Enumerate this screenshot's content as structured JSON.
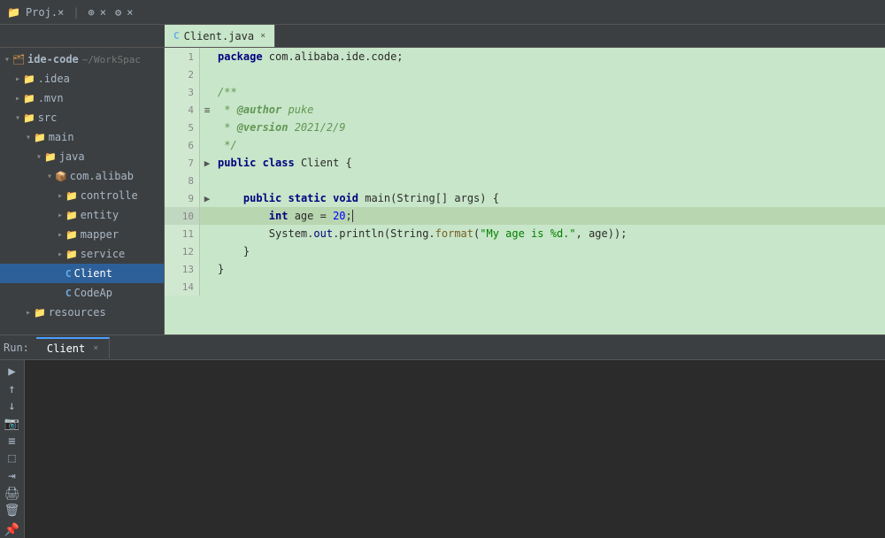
{
  "topbar": {
    "project_icon": "📁",
    "project_name": "Proj.×",
    "actions": [
      "⊕",
      "×",
      "⚙",
      "×"
    ]
  },
  "tabs": [
    {
      "label": "Client.java",
      "icon": "C",
      "active": true,
      "closable": true
    }
  ],
  "sidebar": {
    "title": "ide-code",
    "subtitle": "~/WorkSpac",
    "items": [
      {
        "id": "ide-code",
        "label": "ide-code",
        "indent": 0,
        "type": "root",
        "arrow": "▾",
        "icon": "📁"
      },
      {
        "id": "idea",
        "label": ".idea",
        "indent": 1,
        "type": "folder",
        "arrow": "▸",
        "icon": "📁"
      },
      {
        "id": "mvn",
        "label": ".mvn",
        "indent": 1,
        "type": "folder",
        "arrow": "▸",
        "icon": "📁"
      },
      {
        "id": "src",
        "label": "src",
        "indent": 1,
        "type": "src-folder",
        "arrow": "▾",
        "icon": "📁"
      },
      {
        "id": "main",
        "label": "main",
        "indent": 2,
        "type": "folder",
        "arrow": "▾",
        "icon": "📁"
      },
      {
        "id": "java",
        "label": "java",
        "indent": 3,
        "type": "java-folder",
        "arrow": "▾",
        "icon": "📁"
      },
      {
        "id": "com.alibab",
        "label": "com.alibab",
        "indent": 4,
        "type": "package",
        "arrow": "▾",
        "icon": "📦"
      },
      {
        "id": "controlle",
        "label": "controlle",
        "indent": 5,
        "type": "folder",
        "arrow": "▸",
        "icon": "📁"
      },
      {
        "id": "entity",
        "label": "entity",
        "indent": 5,
        "type": "folder",
        "arrow": "▸",
        "icon": "📁"
      },
      {
        "id": "mapper",
        "label": "mapper",
        "indent": 5,
        "type": "folder",
        "arrow": "▸",
        "icon": "📁"
      },
      {
        "id": "service",
        "label": "service",
        "indent": 5,
        "type": "folder",
        "arrow": "▸",
        "icon": "📁"
      },
      {
        "id": "Client",
        "label": "Client",
        "indent": 5,
        "type": "class",
        "arrow": "",
        "icon": "C",
        "selected": true
      },
      {
        "id": "CodeApp",
        "label": "CodeAp",
        "indent": 5,
        "type": "class",
        "arrow": "",
        "icon": "C"
      },
      {
        "id": "resources",
        "label": "resources",
        "indent": 2,
        "type": "folder",
        "arrow": "▸",
        "icon": "📁"
      }
    ]
  },
  "editor": {
    "lines": [
      {
        "num": 1,
        "arrow": "",
        "highlighted": false,
        "tokens": [
          {
            "t": "kw",
            "v": "package"
          },
          {
            "t": "plain",
            "v": " com.alibaba.ide.code;"
          }
        ]
      },
      {
        "num": 2,
        "arrow": "",
        "highlighted": false,
        "tokens": []
      },
      {
        "num": 3,
        "arrow": "",
        "highlighted": false,
        "tokens": [
          {
            "t": "cm",
            "v": "/**"
          }
        ]
      },
      {
        "num": 4,
        "arrow": "",
        "highlighted": false,
        "tokens": [
          {
            "t": "cm",
            "v": " * "
          },
          {
            "t": "cm-tag",
            "v": "@author"
          },
          {
            "t": "cm",
            "v": " puke"
          }
        ]
      },
      {
        "num": 5,
        "arrow": "",
        "highlighted": false,
        "tokens": [
          {
            "t": "cm",
            "v": " * "
          },
          {
            "t": "cm-tag",
            "v": "@version"
          },
          {
            "t": "cm",
            "v": " 2021/2/9"
          }
        ]
      },
      {
        "num": 6,
        "arrow": "",
        "highlighted": false,
        "tokens": [
          {
            "t": "cm",
            "v": " */"
          }
        ]
      },
      {
        "num": 7,
        "arrow": "▶",
        "highlighted": false,
        "tokens": [
          {
            "t": "kw",
            "v": "public"
          },
          {
            "t": "plain",
            "v": " "
          },
          {
            "t": "kw",
            "v": "class"
          },
          {
            "t": "plain",
            "v": " Client {"
          }
        ]
      },
      {
        "num": 8,
        "arrow": "",
        "highlighted": false,
        "tokens": []
      },
      {
        "num": 9,
        "arrow": "▶",
        "highlighted": false,
        "tokens": [
          {
            "t": "plain",
            "v": "    "
          },
          {
            "t": "kw",
            "v": "public"
          },
          {
            "t": "plain",
            "v": " "
          },
          {
            "t": "kw",
            "v": "static"
          },
          {
            "t": "plain",
            "v": " "
          },
          {
            "t": "kw",
            "v": "void"
          },
          {
            "t": "plain",
            "v": " main(String[] args) {"
          }
        ]
      },
      {
        "num": 10,
        "arrow": "",
        "highlighted": true,
        "tokens": [
          {
            "t": "plain",
            "v": "        "
          },
          {
            "t": "kw",
            "v": "int"
          },
          {
            "t": "plain",
            "v": " age = "
          },
          {
            "t": "num",
            "v": "20"
          },
          {
            "t": "plain",
            "v": ";"
          }
        ],
        "caret_after": 5
      },
      {
        "num": 11,
        "arrow": "",
        "highlighted": false,
        "tokens": [
          {
            "t": "plain",
            "v": "        System."
          },
          {
            "t": "plain",
            "v": "out"
          },
          {
            "t": "plain",
            "v": ".println(String."
          },
          {
            "t": "fn",
            "v": "format"
          },
          {
            "t": "plain",
            "v": "("
          },
          {
            "t": "str",
            "v": "\"My age is %d.\""
          },
          {
            "t": "plain",
            "v": ", age));"
          }
        ]
      },
      {
        "num": 12,
        "arrow": "",
        "highlighted": false,
        "tokens": [
          {
            "t": "plain",
            "v": "    }"
          }
        ]
      },
      {
        "num": 13,
        "arrow": "",
        "highlighted": false,
        "tokens": [
          {
            "t": "plain",
            "v": "}"
          }
        ]
      },
      {
        "num": 14,
        "arrow": "",
        "highlighted": false,
        "tokens": []
      }
    ]
  },
  "bottom_panel": {
    "run_label": "Run:",
    "tabs": [
      {
        "label": "Client",
        "active": true,
        "closable": true
      }
    ],
    "toolbar": {
      "buttons": [
        {
          "icon": "▶",
          "name": "run-btn",
          "enabled": true
        },
        {
          "icon": "↑",
          "name": "scroll-up-btn",
          "enabled": true
        },
        {
          "icon": "↓",
          "name": "scroll-down-btn",
          "enabled": true
        },
        {
          "icon": "📷",
          "name": "screenshot-btn",
          "enabled": false
        },
        {
          "icon": "≡",
          "name": "menu-btn",
          "enabled": true
        },
        {
          "icon": "⬚",
          "name": "grid-btn",
          "enabled": true
        },
        {
          "icon": "⇥",
          "name": "import-btn",
          "enabled": true
        },
        {
          "icon": "🖨",
          "name": "print-btn",
          "enabled": true
        },
        {
          "icon": "🗑",
          "name": "trash-btn",
          "enabled": true
        },
        {
          "icon": "📌",
          "name": "pin-btn",
          "enabled": true
        }
      ]
    }
  }
}
